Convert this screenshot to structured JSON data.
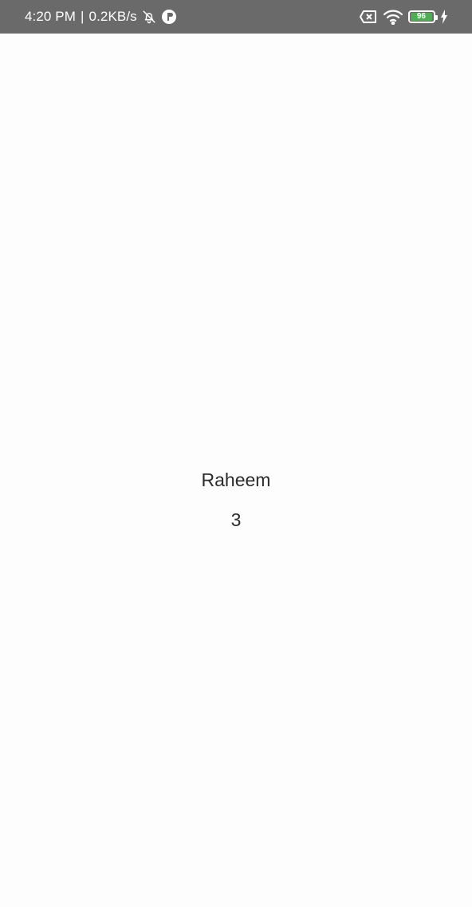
{
  "status_bar": {
    "time": "4:20 PM",
    "separator": "|",
    "network_speed": "0.2KB/s",
    "battery_level": "96",
    "battery_percent": 96,
    "icons": [
      "bell-off-icon",
      "app-notification-icon",
      "sim-none-icon",
      "wifi-icon",
      "battery-icon",
      "charging-icon"
    ],
    "background_color": "#6a6a6a",
    "battery_color": "#4caf50"
  },
  "main": {
    "name": "Raheem",
    "count": "3"
  }
}
